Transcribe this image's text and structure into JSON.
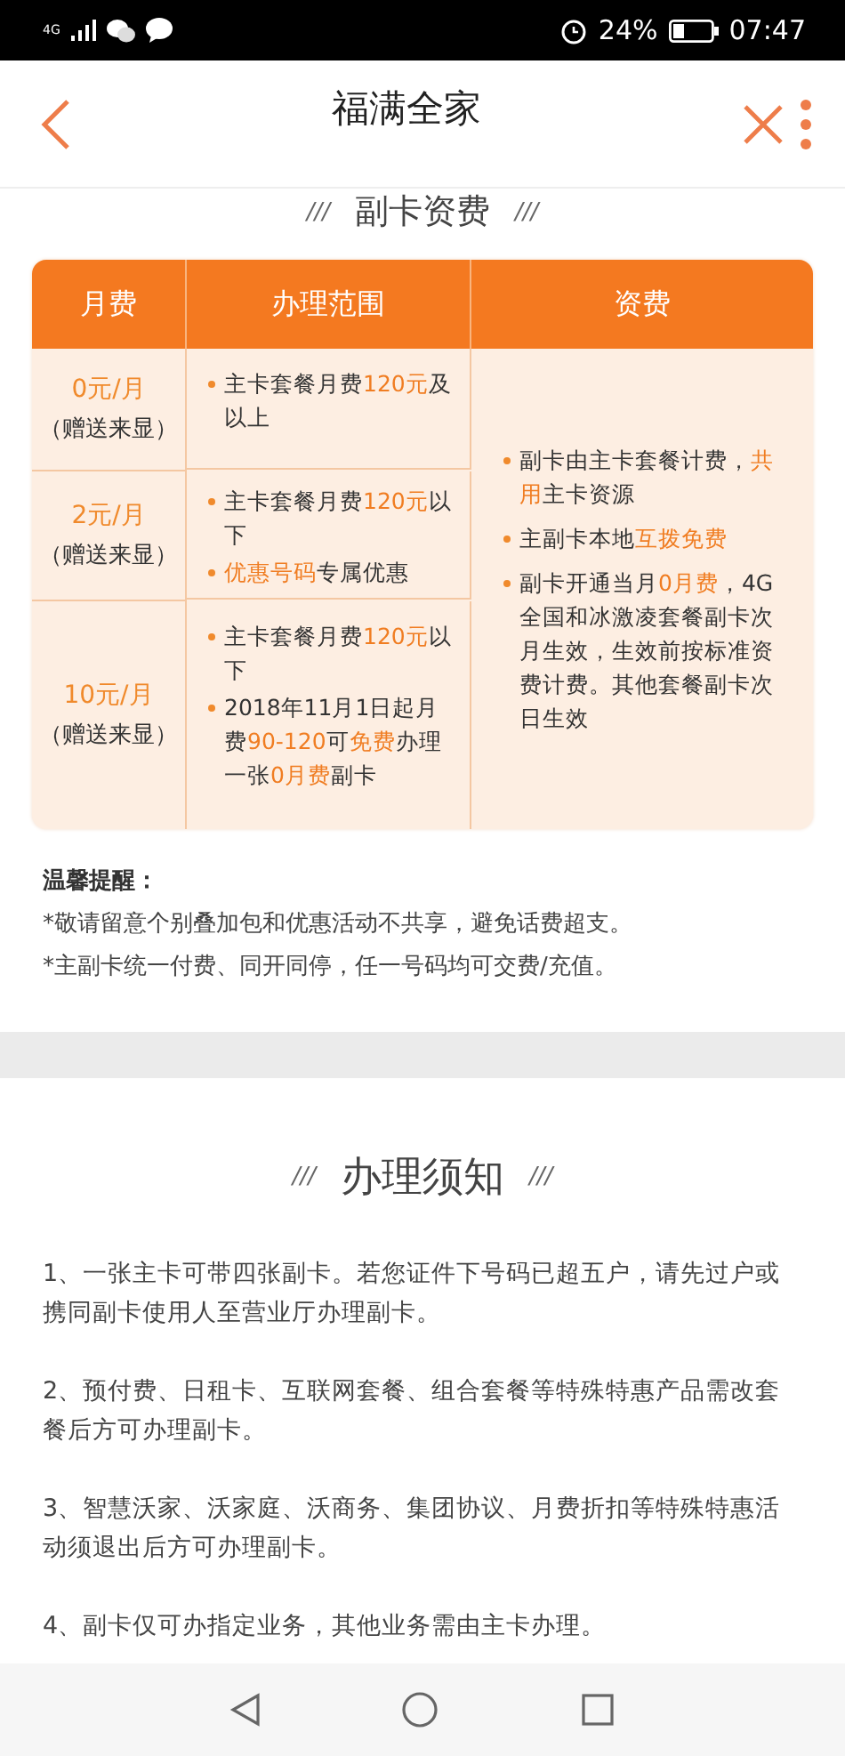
{
  "status_bar": {
    "network": "4G",
    "battery_text": "24%",
    "time": "07:47"
  },
  "header": {
    "title": "福满全家"
  },
  "fee_section": {
    "decor_left": "///",
    "title": "副卡资费",
    "decor_right": "///",
    "columns": [
      "月费",
      "办理范围",
      "资费"
    ],
    "rows": [
      {
        "fee": "0元/月",
        "note": "（赠送来显）",
        "scope": [
          "主卡套餐月费**120元**及以上"
        ]
      },
      {
        "fee": "2元/月",
        "note": "（赠送来显）",
        "scope": [
          "主卡套餐月费**120元**以下",
          "**优惠号码**专属优惠"
        ]
      },
      {
        "fee": "10元/月",
        "note": "（赠送来显）",
        "scope": [
          "主卡套餐月费**120元**以下",
          "2018年11月1日起月费**90-120**可**免费**办理一张**0月费**副卡"
        ]
      }
    ],
    "tariff": [
      "副卡由主卡套餐计费，**共用**主卡资源",
      "主副卡本地**互拨免费**",
      "副卡开通当月**0月费**，4G全国和冰激凌套餐副卡次月生效，生效前按标准资费计费。其他套餐副卡次日生效"
    ]
  },
  "reminder": {
    "title": "温馨提醒：",
    "lines": [
      "*敬请留意个别叠加包和优惠活动不共享，避免话费超支。",
      "*主副卡统一付费、同开同停，任一号码均可交费/充值。"
    ]
  },
  "notice_section": {
    "decor_left": "///",
    "title": "办理须知",
    "decor_right": "///",
    "items": [
      "1、一张主卡可带四张副卡。若您证件下号码已超五户，请先过户或携同副卡使用人至营业厅办理副卡。",
      "2、预付费、日租卡、互联网套餐、组合套餐等特殊特惠产品需改套餐后方可办理副卡。",
      "3、智慧沃家、沃家庭、沃商务、集团协议、月费折扣等特殊特惠活动须退出后方可办理副卡。",
      "4、副卡仅可办指定业务，其他业务需由主卡办理。"
    ]
  }
}
